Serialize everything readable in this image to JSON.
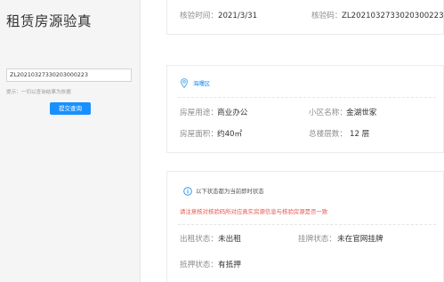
{
  "sidebar": {
    "title": "租赁房源验真",
    "code_value": "ZL20210327330203000223",
    "hint": "提示：一切以查询结果为依据",
    "submit_label": "提交查询"
  },
  "summary": {
    "check_time_label": "核验时间：",
    "check_time_value": "2021/3/31",
    "check_code_label": "核验码：",
    "check_code_value": "ZL202103273302030022​3"
  },
  "property": {
    "district": "海曙区",
    "usage_label": "房屋用途：",
    "usage_value": "商业办公",
    "community_label": "小区名称：",
    "community_value": "金湖世家",
    "area_label": "房屋面积：",
    "area_value": "约40㎡",
    "floors_label": "总楼层数：",
    "floors_value": "12 层"
  },
  "status": {
    "note": "以下状态都为当前即时状态",
    "warning": "请注意核对核验码所对应真实房源信息与核验房源是否一致",
    "rent_label": "出租状态：",
    "rent_value": "未出租",
    "listing_label": "挂牌状态：",
    "listing_value": "未在官网挂牌",
    "mortgage_label": "抵押状态：",
    "mortgage_value": "有抵押"
  },
  "colors": {
    "accent": "#1890ff",
    "warning": "#e8554e",
    "info": "#1890ff"
  },
  "icons": [
    "location-pin-icon",
    "info-circle-icon"
  ]
}
